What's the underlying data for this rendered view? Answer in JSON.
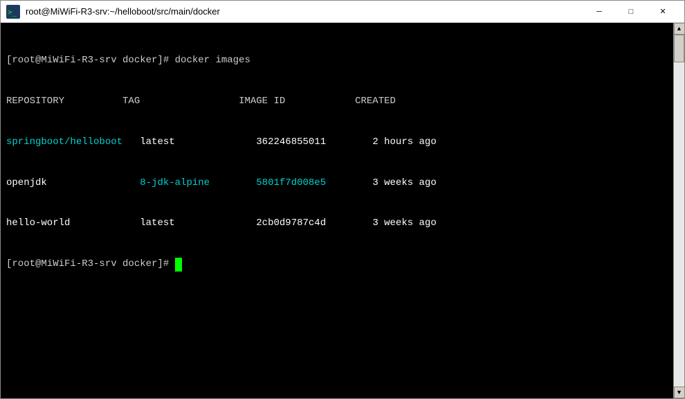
{
  "titlebar": {
    "title": "root@MiWiFi-R3-srv:~/helloboot/src/main/docker",
    "minimize_label": "─",
    "maximize_label": "□",
    "close_label": "✕"
  },
  "terminal": {
    "prompt1": "[root@MiWiFi-R3-srv docker]# docker images",
    "header_repo": "REPOSITORY",
    "header_tag": "TAG",
    "header_imageid": "IMAGE ID",
    "header_created": "CREATED",
    "rows": [
      {
        "repo": "springboot/helloboot",
        "tag": "latest",
        "id": "362246855011",
        "created": "2 hours ago"
      },
      {
        "repo": "openjdk",
        "tag": "8-jdk-alpine",
        "id": "5801f7d008e5",
        "created": "3 weeks ago"
      },
      {
        "repo": "hello-world",
        "tag": "latest",
        "id": "2cb0d9787c4d",
        "created": "3 weeks ago"
      }
    ],
    "prompt2": "[root@MiWiFi-R3-srv docker]# "
  }
}
